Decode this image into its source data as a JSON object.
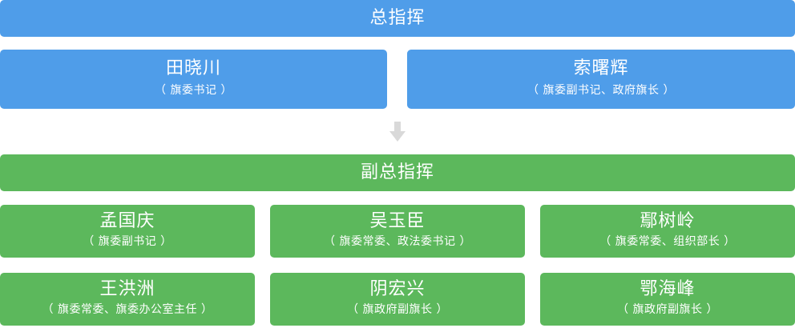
{
  "commander": {
    "title": "总指挥",
    "people": [
      {
        "name": "田晓川",
        "role": "（ 旗委书记 ）"
      },
      {
        "name": "索曙辉",
        "role": "（ 旗委副书记、政府旗长 ）"
      }
    ]
  },
  "deputy": {
    "title": "副总指挥",
    "people": [
      {
        "name": "孟国庆",
        "role": "（ 旗委副书记 ）"
      },
      {
        "name": "吴玉臣",
        "role": "（ 旗委常委、政法委书记 ）"
      },
      {
        "name": "鄢树岭",
        "role": "（ 旗委常委、组织部长 ）"
      },
      {
        "name": "王洪洲",
        "role": "（ 旗委常委、旗委办公室主任 ）"
      },
      {
        "name": "阴宏兴",
        "role": "（ 旗政府副旗长 ）"
      },
      {
        "name": "鄂海峰",
        "role": "（ 旗政府副旗长 ）"
      }
    ]
  },
  "colors": {
    "commander": "#4f9de9",
    "deputy": "#5cb85c",
    "arrow": "#d9d9d9"
  },
  "icons": {
    "connector": "arrow-down-icon"
  }
}
